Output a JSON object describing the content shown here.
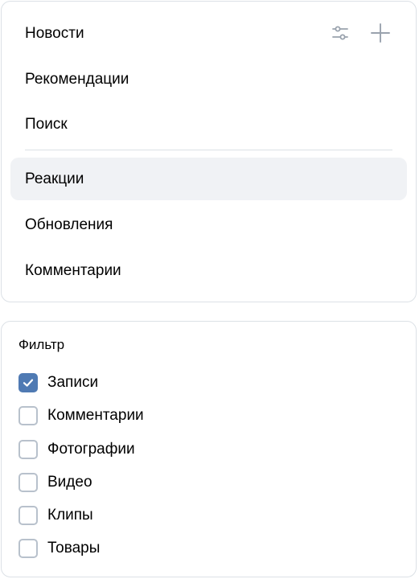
{
  "nav": {
    "items": [
      {
        "label": "Новости",
        "active": false
      },
      {
        "label": "Рекомендации",
        "active": false
      },
      {
        "label": "Поиск",
        "active": false
      },
      {
        "label": "Реакции",
        "active": true
      },
      {
        "label": "Обновления",
        "active": false
      },
      {
        "label": "Комментарии",
        "active": false
      }
    ],
    "icons": [
      "sliders-icon",
      "plus-icon"
    ]
  },
  "filter": {
    "title": "Фильтр",
    "options": [
      {
        "label": "Записи",
        "checked": true
      },
      {
        "label": "Комментарии",
        "checked": false
      },
      {
        "label": "Фотографии",
        "checked": false
      },
      {
        "label": "Видео",
        "checked": false
      },
      {
        "label": "Клипы",
        "checked": false
      },
      {
        "label": "Товары",
        "checked": false
      }
    ]
  },
  "colors": {
    "accent": "#4f7ab3",
    "active_bg": "#f0f2f5",
    "border": "#dce1e6",
    "icon_gray": "#99a2ad"
  }
}
